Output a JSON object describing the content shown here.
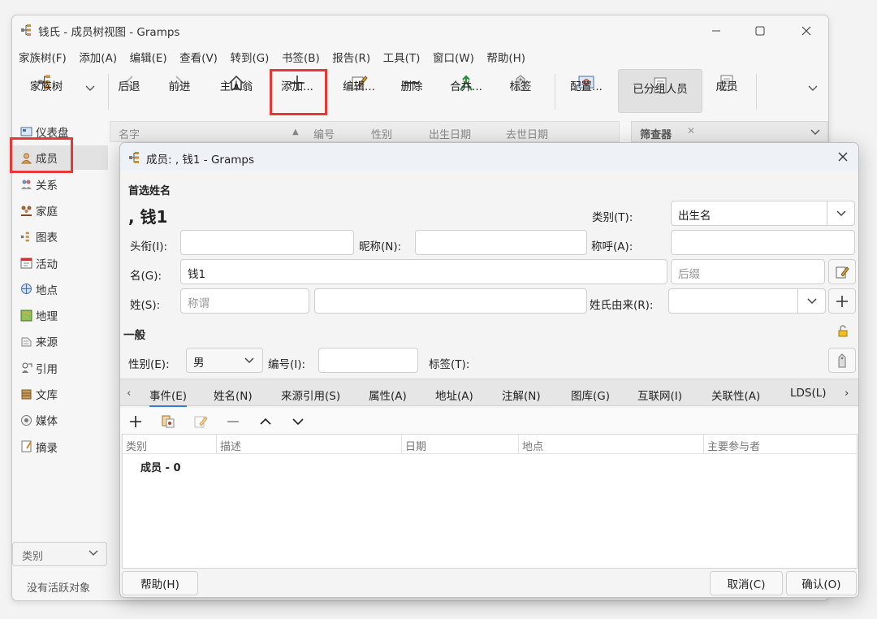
{
  "window": {
    "title": "钱氏 - 成员树视图 - Gramps",
    "controls": [
      "minimize-icon",
      "maximize-icon",
      "close-icon"
    ]
  },
  "menu": [
    "家族树(F)",
    "添加(A)",
    "编辑(E)",
    "查看(V)",
    "转到(G)",
    "书签(B)",
    "报告(R)",
    "工具(T)",
    "窗口(W)",
    "帮助(H)"
  ],
  "toolbar": {
    "family_tree": "家族树",
    "back": "后退",
    "forward": "前进",
    "home": "主人翁",
    "add": "添加...",
    "edit": "编辑...",
    "delete": "删除",
    "merge": "合并...",
    "tag": "标签",
    "configure": "配置...",
    "grouped_people": "已分组人员",
    "people": "成员"
  },
  "sidebar": {
    "items": [
      {
        "label": "仪表盘",
        "icon": "dashboard-icon"
      },
      {
        "label": "成员",
        "icon": "person-icon",
        "active": true
      },
      {
        "label": "关系",
        "icon": "relationship-icon"
      },
      {
        "label": "家庭",
        "icon": "family-icon"
      },
      {
        "label": "图表",
        "icon": "chart-icon"
      },
      {
        "label": "活动",
        "icon": "event-icon"
      },
      {
        "label": "地点",
        "icon": "place-icon"
      },
      {
        "label": "地理",
        "icon": "geography-icon"
      },
      {
        "label": "来源",
        "icon": "source-icon"
      },
      {
        "label": "引用",
        "icon": "citation-icon"
      },
      {
        "label": "文库",
        "icon": "repository-icon"
      },
      {
        "label": "媒体",
        "icon": "media-icon"
      },
      {
        "label": "摘录",
        "icon": "note-icon"
      }
    ],
    "category_placeholder": "类别",
    "status": "没有活跃对象"
  },
  "list": {
    "columns": [
      "名字",
      "编号",
      "性别",
      "出生日期",
      "去世日期"
    ],
    "filter_tab": "筛查器"
  },
  "dialog": {
    "title": "成员: , 钱1 - Gramps",
    "preferred_name_heading": "首选姓名",
    "display_name": ", 钱1",
    "type_label": "类别(T):",
    "type_value": "出生名",
    "title_label": "头衔(I):",
    "nickname_label": "昵称(N):",
    "call_label": "称呼(A):",
    "given_label": "名(G):",
    "given_value": "钱1",
    "suffix_placeholder": "后缀",
    "surname_label": "姓(S):",
    "prefix_placeholder": "称谓",
    "origin_label": "姓氏由来(R):",
    "general_heading": "一般",
    "gender_label": "性别(E):",
    "gender_value": "男",
    "id_label": "编号(I):",
    "tags_label": "标签(T):",
    "tabs": [
      "事件(E)",
      "姓名(N)",
      "来源引用(S)",
      "属性(A)",
      "地址(A)",
      "注解(N)",
      "图库(G)",
      "互联网(I)",
      "关联性(A)",
      "LDS(L)"
    ],
    "event_columns": [
      "类别",
      "描述",
      "日期",
      "地点",
      "主要参与者"
    ],
    "event_group": "成员 - 0",
    "help_button": "帮助(H)",
    "cancel_button": "取消(C)",
    "ok_button": "确认(O)"
  },
  "colors": {
    "highlight": "#e53935",
    "tab_underline": "#3b7bd5"
  }
}
